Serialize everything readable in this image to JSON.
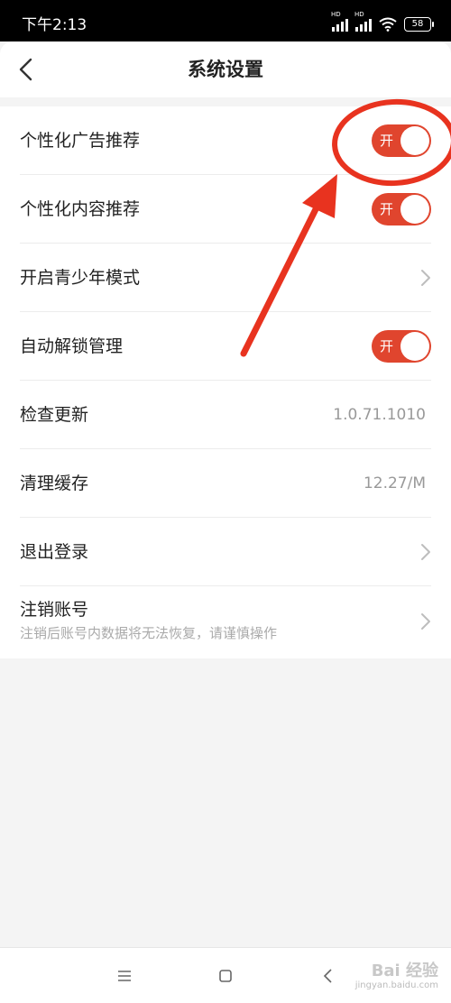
{
  "status_bar": {
    "time": "下午2:13",
    "signal_label": "HD",
    "battery": "58"
  },
  "header": {
    "title": "系统设置"
  },
  "settings": [
    {
      "label": "个性化广告推荐",
      "control": "toggle",
      "toggle_text": "开"
    },
    {
      "label": "个性化内容推荐",
      "control": "toggle",
      "toggle_text": "开"
    },
    {
      "label": "开启青少年模式",
      "control": "chevron"
    },
    {
      "label": "自动解锁管理",
      "control": "toggle",
      "toggle_text": "开"
    },
    {
      "label": "检查更新",
      "control": "value",
      "value": "1.0.71.1010"
    },
    {
      "label": "清理缓存",
      "control": "value",
      "value": "12.27/M"
    },
    {
      "label": "退出登录",
      "control": "chevron"
    },
    {
      "label": "注销账号",
      "control": "chevron",
      "sublabel": "注销后账号内数据将无法恢复，请谨慎操作"
    }
  ],
  "watermark": {
    "line1": "Bai 经验",
    "line2": "jingyan.baidu.com"
  },
  "colors": {
    "accent": "#e0452e",
    "annotation": "#e8331f",
    "background": "#f4f4f4"
  }
}
